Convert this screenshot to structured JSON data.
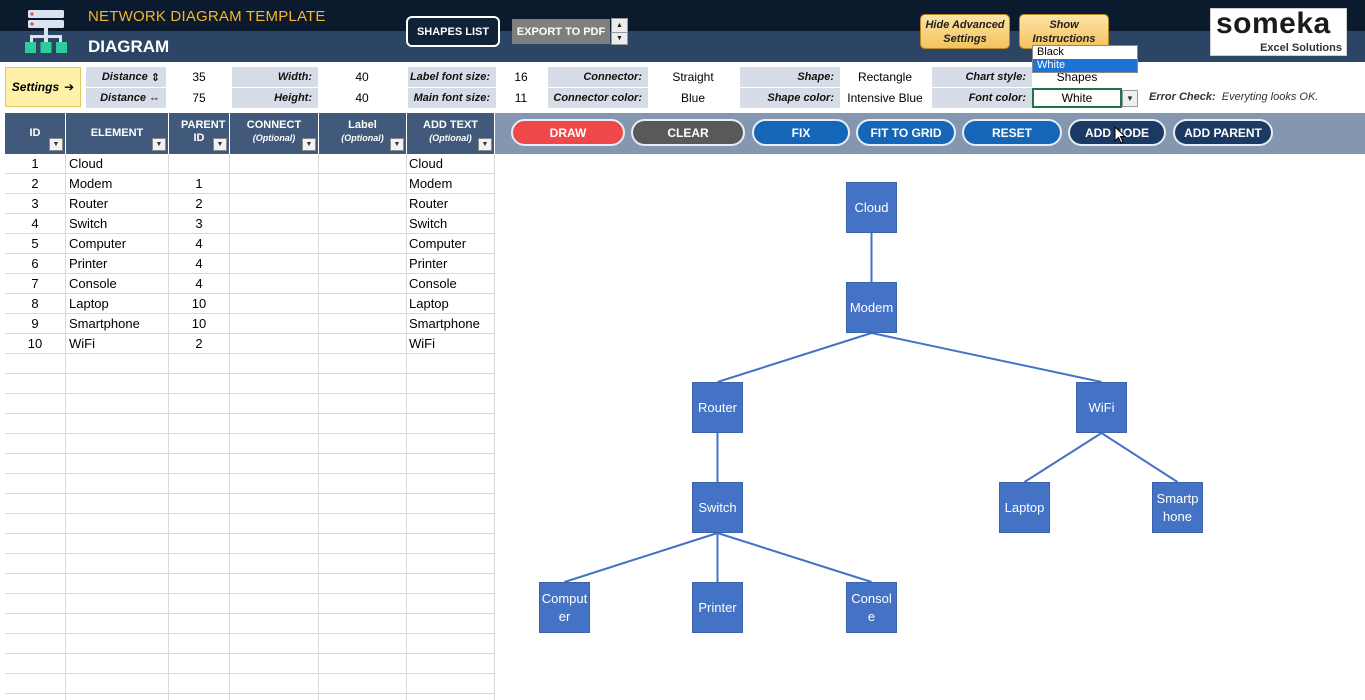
{
  "header": {
    "app_title": "NETWORK DIAGRAM TEMPLATE",
    "page_title": "DIAGRAM",
    "shapes_list_label": "SHAPES LIST",
    "export_label": "EXPORT  TO PDF",
    "hide_settings_label": "Hide Advanced Settings",
    "show_instructions_label": "Show Instructions",
    "brand_name": "someka",
    "brand_tagline": "Excel Solutions",
    "colors": {
      "top_bar": "#0b1a2c",
      "bottom_bar": "#2c4565",
      "title_accent": "#f5b62e"
    }
  },
  "settings": {
    "button_label": "Settings",
    "distance_vertical": {
      "label": "Distance",
      "value": "35"
    },
    "distance_horizontal": {
      "label": "Distance",
      "value": "75"
    },
    "width": {
      "label": "Width:",
      "value": "40"
    },
    "height": {
      "label": "Height:",
      "value": "40"
    },
    "label_font_size": {
      "label": "Label font size:",
      "value": "16"
    },
    "main_font_size": {
      "label": "Main font size:",
      "value": "11"
    },
    "connector": {
      "label": "Connector:",
      "value": "Straight"
    },
    "connector_color": {
      "label": "Connector color:",
      "value": "Blue"
    },
    "shape": {
      "label": "Shape:",
      "value": "Rectangle"
    },
    "shape_color": {
      "label": "Shape color:",
      "value": "Intensive Blue"
    },
    "chart_style": {
      "label": "Chart style:",
      "value": "Shapes"
    },
    "font_color": {
      "label": "Font color:",
      "value": "White",
      "options": [
        "Black",
        "White"
      ],
      "highlighted": "White"
    },
    "error_check": {
      "label": "Error Check:",
      "message": "Everyting looks OK."
    }
  },
  "table": {
    "columns": [
      {
        "title": "ID",
        "sub": ""
      },
      {
        "title": "ELEMENT",
        "sub": ""
      },
      {
        "title": "PARENT ID",
        "sub": ""
      },
      {
        "title": "CONNECT",
        "sub": "(Optional)"
      },
      {
        "title": "Label",
        "sub": "(Optional)"
      },
      {
        "title": "ADD TEXT",
        "sub": "(Optional)"
      }
    ],
    "rows": [
      {
        "id": "1",
        "element": "Cloud",
        "parent": "",
        "connect": "",
        "label": "",
        "text": "Cloud"
      },
      {
        "id": "2",
        "element": "Modem",
        "parent": "1",
        "connect": "",
        "label": "",
        "text": "Modem"
      },
      {
        "id": "3",
        "element": "Router",
        "parent": "2",
        "connect": "",
        "label": "",
        "text": "Router"
      },
      {
        "id": "4",
        "element": "Switch",
        "parent": "3",
        "connect": "",
        "label": "",
        "text": "Switch"
      },
      {
        "id": "5",
        "element": "Computer",
        "parent": "4",
        "connect": "",
        "label": "",
        "text": "Computer"
      },
      {
        "id": "6",
        "element": "Printer",
        "parent": "4",
        "connect": "",
        "label": "",
        "text": "Printer"
      },
      {
        "id": "7",
        "element": "Console",
        "parent": "4",
        "connect": "",
        "label": "",
        "text": "Console"
      },
      {
        "id": "8",
        "element": "Laptop",
        "parent": "10",
        "connect": "",
        "label": "",
        "text": "Laptop"
      },
      {
        "id": "9",
        "element": "Smartphone",
        "parent": "10",
        "connect": "",
        "label": "",
        "text": "Smartphone"
      },
      {
        "id": "10",
        "element": "WiFi",
        "parent": "2",
        "connect": "",
        "label": "",
        "text": "WiFi"
      }
    ]
  },
  "actions": {
    "draw": "DRAW",
    "clear": "CLEAR",
    "fix": "FIX",
    "fit_to_grid": "FIT TO GRID",
    "reset": "RESET",
    "add_node": "ADD NODE",
    "add_parent": "ADD PARENT"
  },
  "diagram": {
    "node_color": "#4472c4",
    "connector_color": "#4472c4",
    "nodes": [
      {
        "id": "1",
        "text": "Cloud"
      },
      {
        "id": "2",
        "text": "Modem"
      },
      {
        "id": "3",
        "text": "Router"
      },
      {
        "id": "10",
        "text": "WiFi"
      },
      {
        "id": "4",
        "text": "Switch"
      },
      {
        "id": "8",
        "text": "Laptop"
      },
      {
        "id": "9",
        "text": "Smartp hone"
      },
      {
        "id": "5",
        "text": "Comput er"
      },
      {
        "id": "6",
        "text": "Printer"
      },
      {
        "id": "7",
        "text": "Console"
      }
    ]
  }
}
